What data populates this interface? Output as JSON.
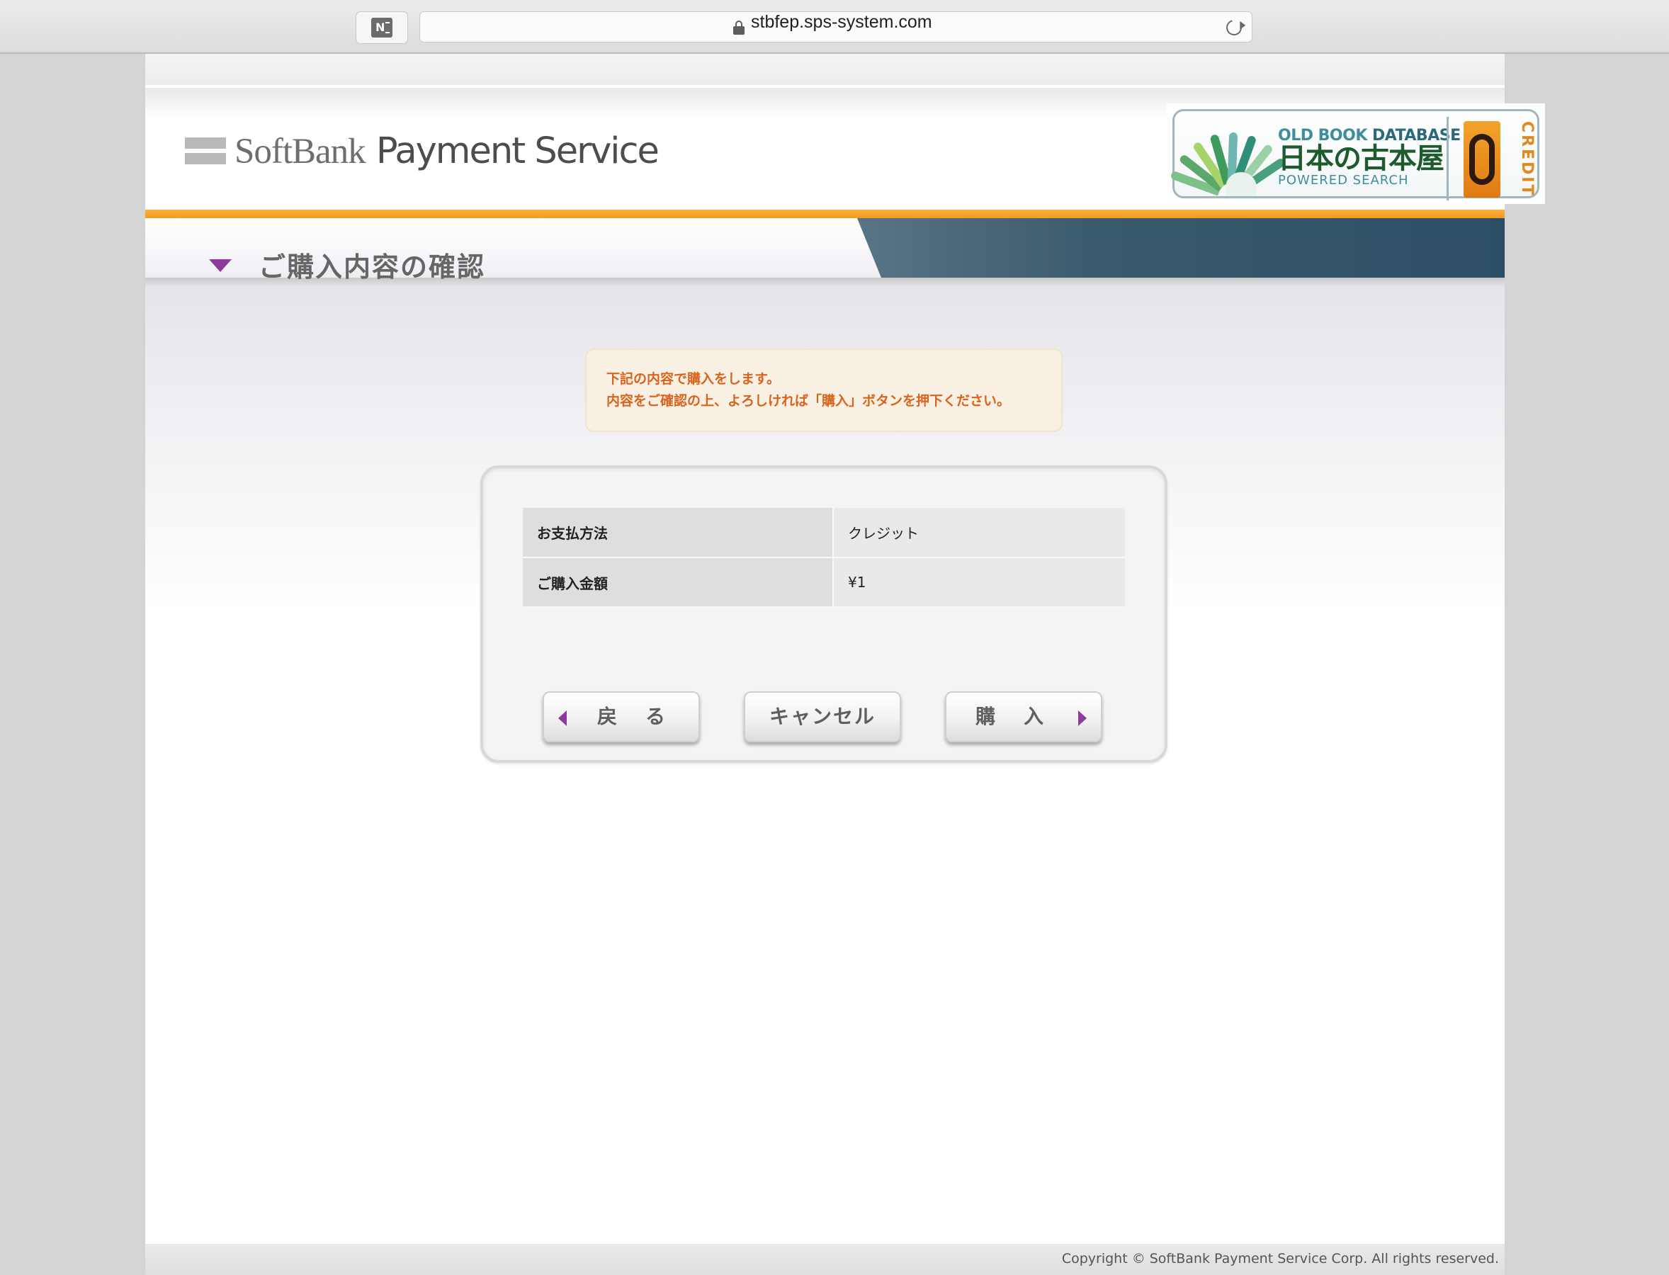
{
  "browser": {
    "url": "stbfep.sps-system.com"
  },
  "header": {
    "brand_light": "SoftBank",
    "brand_bold": "Payment Service",
    "store_logo": {
      "line1_light": "OLD BOOK ",
      "line1_bold": "DATABASE",
      "name_jp": "日本の古本屋",
      "line3": "POWERED SEARCH",
      "badge": "CREDIT"
    }
  },
  "page_title": "ご購入内容の確認",
  "notice": {
    "line1": "下記の内容で購入をします。",
    "line2": "内容をご確認の上、よろしければ「購入」ボタンを押下ください。"
  },
  "details": {
    "rows": [
      {
        "label": "お支払方法",
        "value": "クレジット"
      },
      {
        "label": "ご購入金額",
        "value": "¥1"
      }
    ]
  },
  "buttons": {
    "back": "戻　る",
    "cancel": "キャンセル",
    "buy": "購　入"
  },
  "footer": {
    "copyright": "Copyright © SoftBank Payment Service Corp. All rights reserved."
  },
  "colors": {
    "accent_orange": "#f39a1c",
    "notice_text": "#d8641e",
    "arrow_purple": "#8e3a9c"
  }
}
